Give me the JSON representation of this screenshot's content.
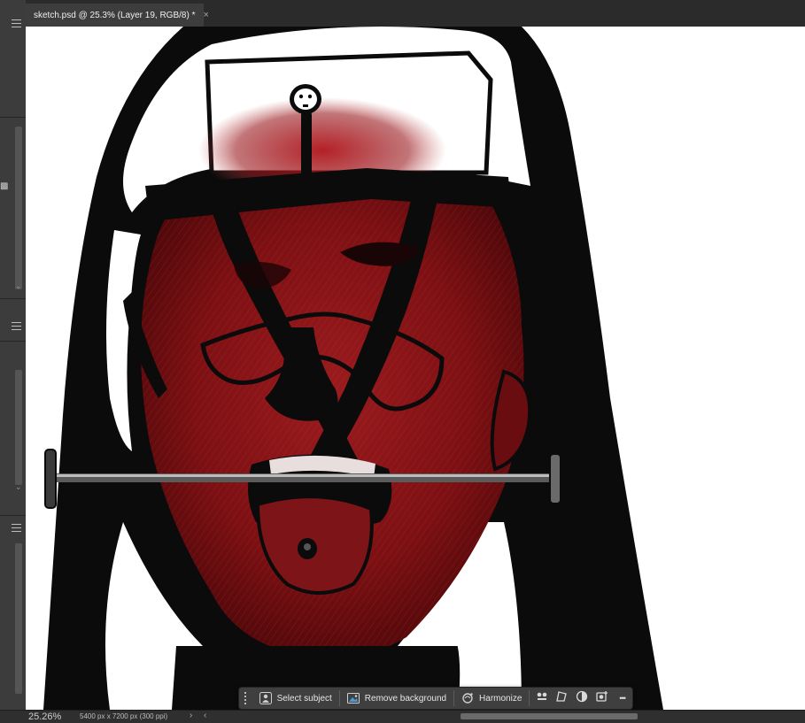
{
  "document_tab": {
    "title": "sketch.psd @ 25.3% (Layer 19, RGB/8) *",
    "close": "×"
  },
  "task_bar": {
    "select_subject": "Select subject",
    "remove_background": "Remove background",
    "harmonize": "Harmonize",
    "more": "•••"
  },
  "status_bar": {
    "zoom": "25.26%",
    "doc_info": "5400 px x 7200 px (300 ppi)",
    "arrow": "›",
    "arrow2": "‹"
  },
  "left_strip": {
    "chevron": "⌄"
  },
  "colors": {
    "canvas": "#ffffff",
    "ink": "#0b0b0b",
    "blood": "#8e1216",
    "blood_dark": "#5e0b0e",
    "ui_dark": "#2b2b2b",
    "ui_panel": "#3f3f3f"
  }
}
